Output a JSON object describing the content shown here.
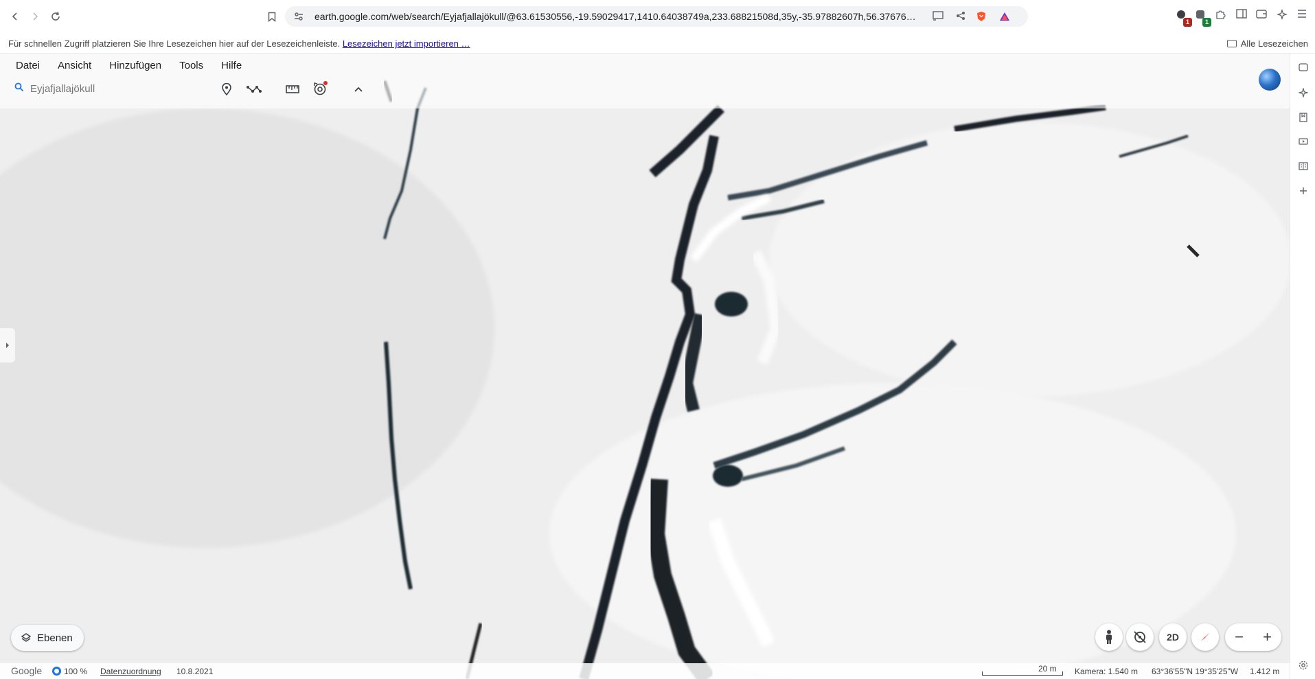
{
  "browser": {
    "url": "earth.google.com/web/search/Eyjafjallajökull/@63.61530556,-19.59029417,1410.64038749a,233.68821508d,35y,-35.97882607h,56.37676…",
    "extension_badges": [
      "1",
      "1"
    ]
  },
  "bookmarks_bar": {
    "hint": "Für schnellen Zugriff platzieren Sie Ihre Lesezeichen hier auf der Lesezeichenleiste.",
    "import_link": "Lesezeichen jetzt importieren …",
    "all_bookmarks": "Alle Lesezeichen"
  },
  "earth": {
    "menu": [
      "Datei",
      "Ansicht",
      "Hinzufügen",
      "Tools",
      "Hilfe"
    ],
    "search_placeholder": "Eyjafjallajökull",
    "layers_label": "Ebenen",
    "view_mode": "2D",
    "status": {
      "brand": "Google",
      "percent": "100 %",
      "attribution": "Datenzuordnung",
      "date": "10.8.2021",
      "scale": "20 m",
      "camera": "Kamera: 1.540 m",
      "coords": "63°36'55\"N 19°35'25\"W",
      "elevation": "1.412 m"
    }
  },
  "colors": {
    "accent": "#1a73e8",
    "badge_red": "#b3261e",
    "badge_green": "#188038",
    "compass": "#e8534a"
  }
}
